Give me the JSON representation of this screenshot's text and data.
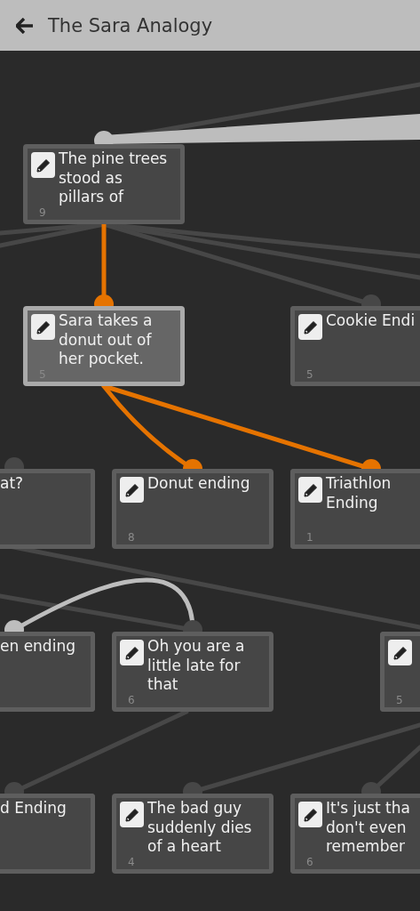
{
  "header": {
    "title": "The Sara Analogy"
  },
  "nodes": [
    {
      "kind": "full",
      "text_lines": [
        "The pine trees",
        "stood as",
        "pillars of"
      ],
      "count": "9",
      "selected": false
    },
    {
      "kind": "full",
      "text_lines": [
        "Sara takes a",
        "donut out of",
        "her pocket."
      ],
      "count": "5",
      "selected": true
    },
    {
      "kind": "cut_right",
      "text_lines": [
        "Cookie Endi"
      ],
      "count": "5",
      "selected": false
    },
    {
      "kind": "cut_left",
      "text_lines": [
        "at?"
      ],
      "selected": false
    },
    {
      "kind": "full",
      "text_lines": [
        "Donut ending"
      ],
      "count": "8",
      "selected": false
    },
    {
      "kind": "cut_right",
      "text_lines": [
        "Triathlon",
        "Ending"
      ],
      "count": "1",
      "selected": false
    },
    {
      "kind": "cut_left",
      "text_lines": [
        "en ending"
      ],
      "selected": false
    },
    {
      "kind": "full",
      "text_lines": [
        "Oh you are a",
        "little late for",
        "that"
      ],
      "count": "6",
      "selected": false
    },
    {
      "kind": "cut_right",
      "count": "5",
      "selected": false
    },
    {
      "kind": "cut_left",
      "text_lines": [
        "d Ending"
      ],
      "selected": false
    },
    {
      "kind": "full",
      "text_lines": [
        "The bad guy",
        "suddenly dies",
        "of a heart"
      ],
      "count": "4",
      "selected": false
    },
    {
      "kind": "cut_right",
      "text_lines": [
        "It's just tha",
        "don't even",
        "remember"
      ],
      "count": "6",
      "selected": false
    }
  ]
}
